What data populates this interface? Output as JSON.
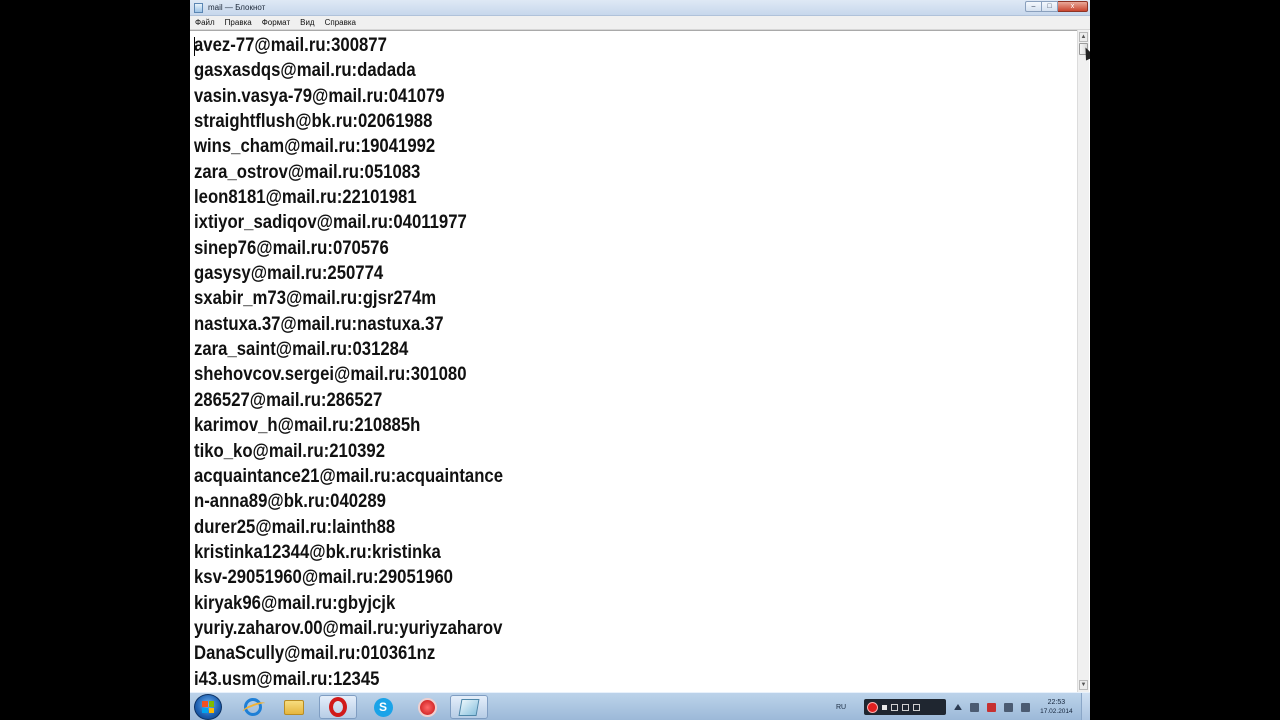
{
  "window": {
    "title": "mail — Блокнот",
    "controls": {
      "minimize": "–",
      "maximize": "□",
      "close": "x"
    }
  },
  "menu": [
    "Файл",
    "Правка",
    "Формат",
    "Вид",
    "Справка"
  ],
  "document": {
    "lines": [
      "avez-77@mail.ru:300877",
      "gasxasdqs@mail.ru:dadada",
      "vasin.vasya-79@mail.ru:041079",
      "straightflush@bk.ru:02061988",
      "wins_cham@mail.ru:19041992",
      "zara_ostrov@mail.ru:051083",
      "leon8181@mail.ru:22101981",
      "ixtiyor_sadiqov@mail.ru:04011977",
      "sinep76@mail.ru:070576",
      "gasysy@mail.ru:250774",
      "sxabir_m73@mail.ru:gjsr274m",
      "nastuxa.37@mail.ru:nastuxa.37",
      "zara_saint@mail.ru:031284",
      "shehovcov.sergei@mail.ru:301080",
      "286527@mail.ru:286527",
      "karimov_h@mail.ru:210885h",
      "tiko_ko@mail.ru:210392",
      "acquaintance21@mail.ru:acquaintance",
      "n-anna89@bk.ru:040289",
      "durer25@mail.ru:lainth88",
      "kristinka12344@bk.ru:kristinka",
      "ksv-29051960@mail.ru:29051960",
      "kiryak96@mail.ru:gbyjcjk",
      "yuriy.zaharov.00@mail.ru:yuriyzaharov",
      "DanaScully@mail.ru:010361nz",
      "i43.usm@mail.ru:12345"
    ]
  },
  "scrollbar": {
    "up": "▲",
    "down": "▼"
  },
  "taskbar": {
    "apps": [
      {
        "name": "internet-explorer-icon",
        "active": false
      },
      {
        "name": "folder-icon",
        "active": false
      },
      {
        "name": "opera-icon",
        "active": true
      },
      {
        "name": "skype-icon",
        "label": "S",
        "active": false
      },
      {
        "name": "record-icon",
        "active": false
      },
      {
        "name": "notepad-icon",
        "active": true
      }
    ],
    "tray": {
      "language": "RU",
      "time": "22:53",
      "date": "17.02.2014"
    }
  }
}
